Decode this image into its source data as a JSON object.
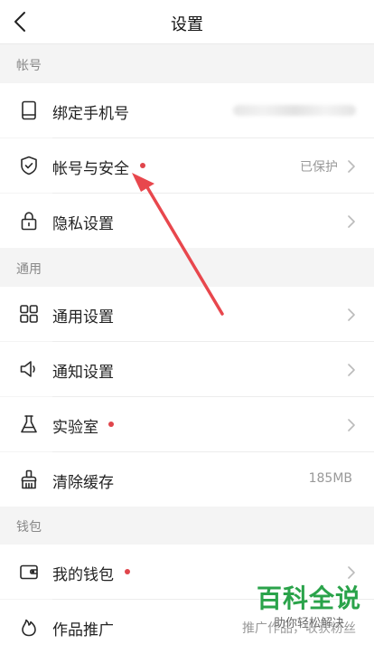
{
  "nav": {
    "title": "设置",
    "back_icon": "chevron-left-icon"
  },
  "sections": {
    "account": {
      "label": "帐号",
      "items": [
        {
          "label": "绑定手机号",
          "icon": "phone-icon"
        },
        {
          "label": "帐号与安全",
          "icon": "shield-icon",
          "value": "已保护",
          "badge_color": "#e0454b"
        },
        {
          "label": "隐私设置",
          "icon": "lock-icon"
        }
      ]
    },
    "general": {
      "label": "通用",
      "items": [
        {
          "label": "通用设置",
          "icon": "grid-icon"
        },
        {
          "label": "通知设置",
          "icon": "speaker-icon"
        },
        {
          "label": "实验室",
          "icon": "flask-icon",
          "badge_color": "#e0454b"
        },
        {
          "label": "清除缓存",
          "icon": "broom-icon",
          "value": "185MB"
        }
      ]
    },
    "wallet": {
      "label": "钱包",
      "items": [
        {
          "label": "我的钱包",
          "icon": "wallet-icon",
          "badge_color": "#e0454b"
        },
        {
          "label": "作品推广",
          "icon": "flame-icon",
          "value": "推广作品，收获粉丝"
        }
      ]
    }
  },
  "watermark": {
    "brand": "百科全说",
    "slogan": "助你轻松解决",
    "brand_color": "#2aa34a"
  },
  "annotation": {
    "arrow_color": "#e8474d"
  }
}
